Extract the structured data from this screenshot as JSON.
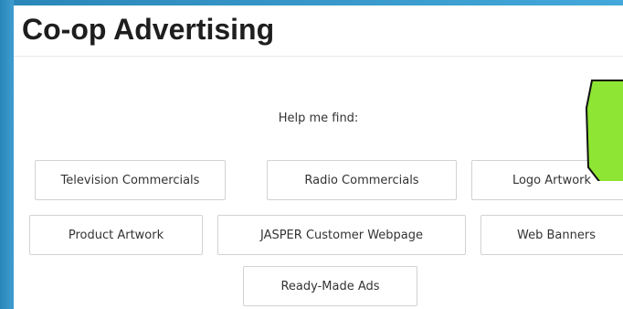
{
  "page": {
    "title": "Co-op Advertising",
    "help_label": "Help me find:"
  },
  "buttons": [
    {
      "label": "Television Commercials"
    },
    {
      "label": "Radio Commercials"
    },
    {
      "label": "Logo Artwork"
    },
    {
      "label": "Product Artwork"
    },
    {
      "label": "JASPER Customer Webpage"
    },
    {
      "label": "Web Banners"
    },
    {
      "label": "Ready-Made Ads"
    }
  ],
  "colors": {
    "frame": "#3f9dd0",
    "annotation_fill": "#8ee534",
    "annotation_stroke": "#111111"
  }
}
